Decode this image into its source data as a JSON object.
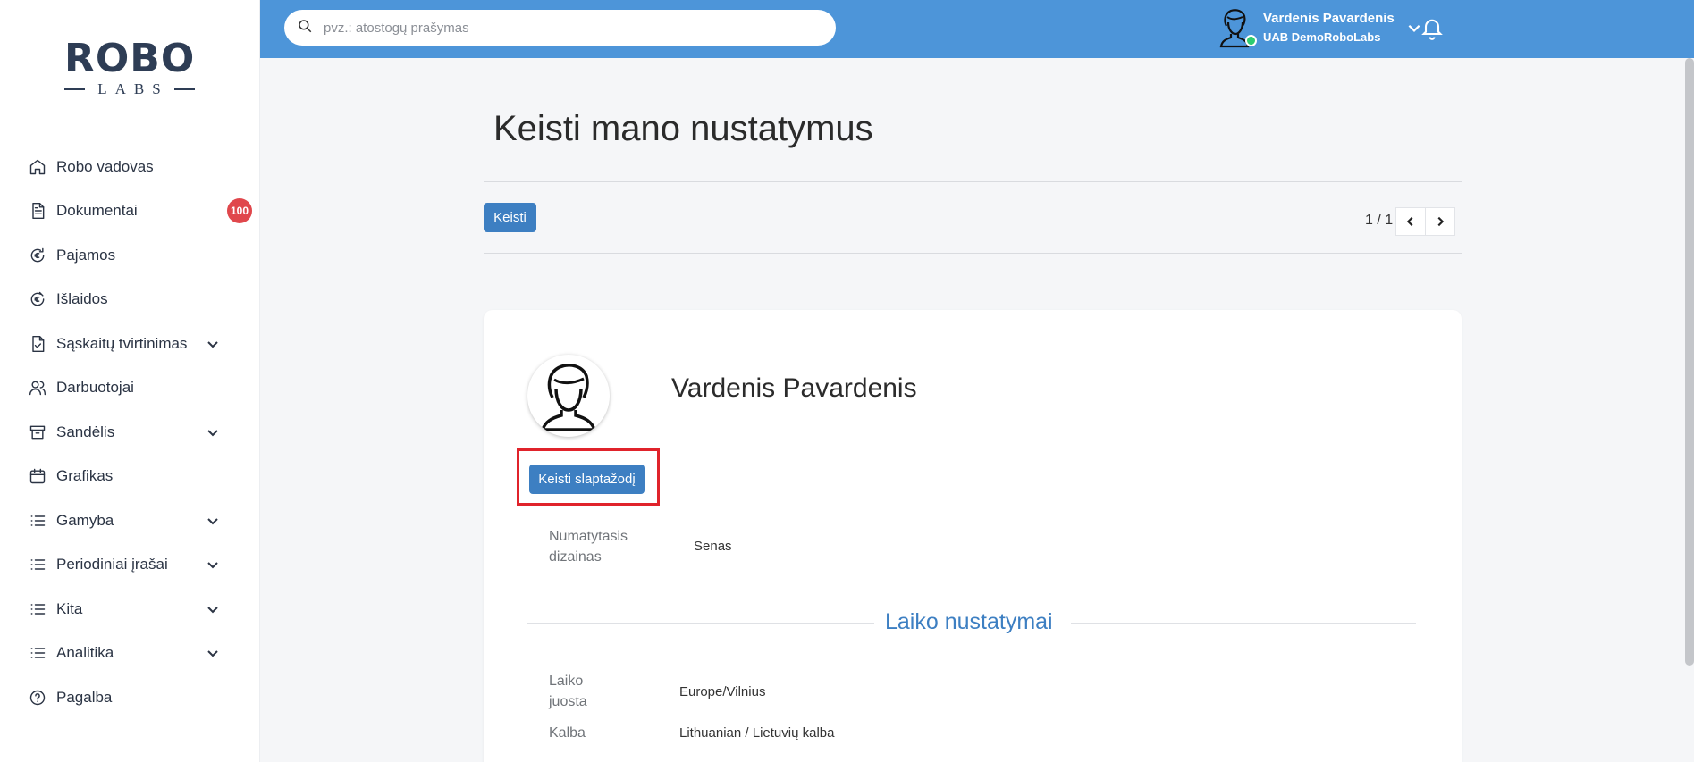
{
  "brand": {
    "logo_top": "ROBO",
    "logo_bottom": "LABS"
  },
  "sidebar": {
    "items": [
      {
        "label": "Robo vadovas",
        "icon": "home-icon"
      },
      {
        "label": "Dokumentai",
        "icon": "document-icon",
        "badge": "100"
      },
      {
        "label": "Pajamos",
        "icon": "euro-income-icon"
      },
      {
        "label": "Išlaidos",
        "icon": "euro-expense-icon"
      },
      {
        "label": "Sąskaitų tvirtinimas",
        "icon": "file-check-icon",
        "expandable": true
      },
      {
        "label": "Darbuotojai",
        "icon": "users-icon"
      },
      {
        "label": "Sandėlis",
        "icon": "archive-icon",
        "expandable": true
      },
      {
        "label": "Grafikas",
        "icon": "calendar-icon"
      },
      {
        "label": "Gamyba",
        "icon": "list-icon",
        "expandable": true
      },
      {
        "label": "Periodiniai įrašai",
        "icon": "list-icon",
        "expandable": true
      },
      {
        "label": "Kita",
        "icon": "list-icon",
        "expandable": true
      },
      {
        "label": "Analitika",
        "icon": "list-icon",
        "expandable": true
      },
      {
        "label": "Pagalba",
        "icon": "help-icon"
      }
    ]
  },
  "topbar": {
    "search_placeholder": "pvz.: atostogų prašymas",
    "user_name": "Vardenis Pavardenis",
    "user_company": "UAB DemoRoboLabs",
    "accent_color": "#4d95d9",
    "status_color": "#2ecc71"
  },
  "main": {
    "title": "Keisti mano nustatymus",
    "edit_button": "Keisti",
    "pager": "1 / 1",
    "profile": {
      "name": "Vardenis Pavardenis",
      "change_password_button": "Keisti slaptažodį",
      "default_design_label": "Numatytasis dizainas",
      "default_design_value": "Senas"
    },
    "time_section": {
      "title": "Laiko nustatymai",
      "timezone_label": "Laiko juosta",
      "timezone_value": "Europe/Vilnius",
      "language_label": "Kalba",
      "language_value": "Lithuanian / Lietuvių kalba"
    }
  }
}
